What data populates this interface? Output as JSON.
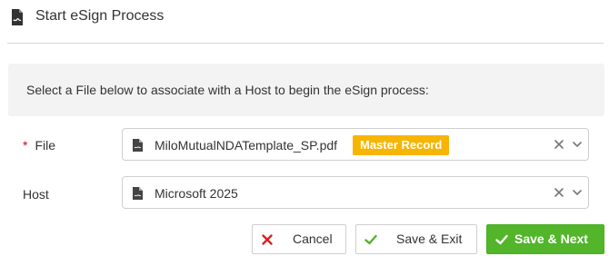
{
  "header": {
    "title": "Start eSign Process",
    "icon": "file-signature-icon"
  },
  "instruction": {
    "text": "Select a File below to associate with a Host to begin the eSign process:"
  },
  "fields": {
    "file": {
      "label": "File",
      "required_marker": "*",
      "value": "MiloMutualNDATemplate_SP.pdf",
      "badge": "Master Record",
      "icon": "pdf-file-icon"
    },
    "host": {
      "label": "Host",
      "value": "Microsoft 2025",
      "icon": "pdf-file-icon"
    }
  },
  "buttons": {
    "cancel": "Cancel",
    "save_exit": "Save & Exit",
    "save_next": "Save & Next"
  },
  "colors": {
    "accent_green": "#52b52a",
    "badge_orange": "#f7b500",
    "required_red": "#d0021b",
    "cancel_red": "#e02020"
  }
}
